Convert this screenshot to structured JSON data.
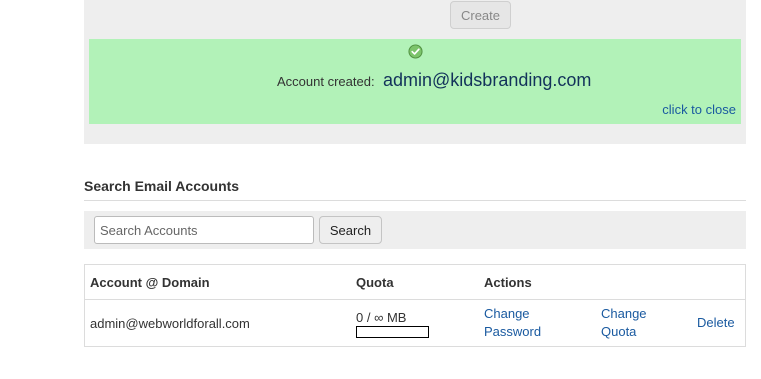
{
  "form": {
    "create_label": "Create"
  },
  "notice": {
    "label": "Account created:",
    "email": "admin@kidsbranding.com",
    "close_label": "click to close",
    "icon": "check-circle-icon",
    "bg_color": "#b2f2b8"
  },
  "search": {
    "title": "Search Email Accounts",
    "placeholder": "Search Accounts",
    "value": "",
    "button_label": "Search"
  },
  "table": {
    "headers": {
      "account": "Account @ Domain",
      "quota": "Quota",
      "actions": "Actions"
    },
    "rows": [
      {
        "account": "admin@webworldforall.com",
        "quota_text": "0 / ∞ MB",
        "quota_fraction": 0,
        "action_change_password_line1": "Change",
        "action_change_password_line2": "Password",
        "action_change_quota_line1": "Change",
        "action_change_quota_line2": "Quota",
        "action_delete": "Delete"
      }
    ]
  }
}
